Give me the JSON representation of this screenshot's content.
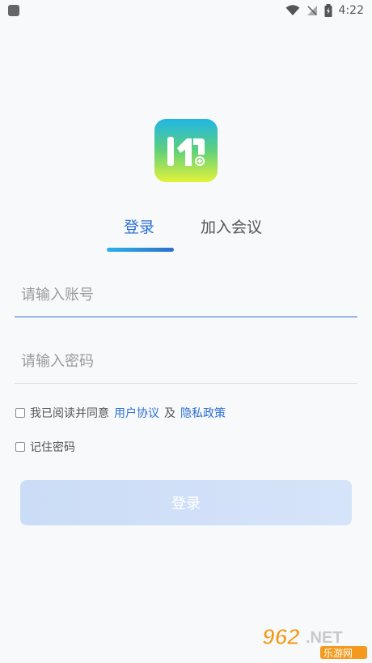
{
  "status_bar": {
    "time": "4:22"
  },
  "tabs": {
    "login": "登录",
    "join": "加入会议"
  },
  "form": {
    "account_placeholder": "请输入账号",
    "password_placeholder": "请输入密码"
  },
  "agreement": {
    "prefix": "我已阅读并同意",
    "user_agreement": "用户协议",
    "and": "及",
    "privacy_policy": "隐私政策"
  },
  "remember_label": "记住密码",
  "login_button": "登录",
  "watermark": {
    "number": "962",
    "net": ".NET",
    "name": "乐游网"
  },
  "colors": {
    "accent": "#2c6fd3",
    "button_bg": "#d0e0f8"
  }
}
